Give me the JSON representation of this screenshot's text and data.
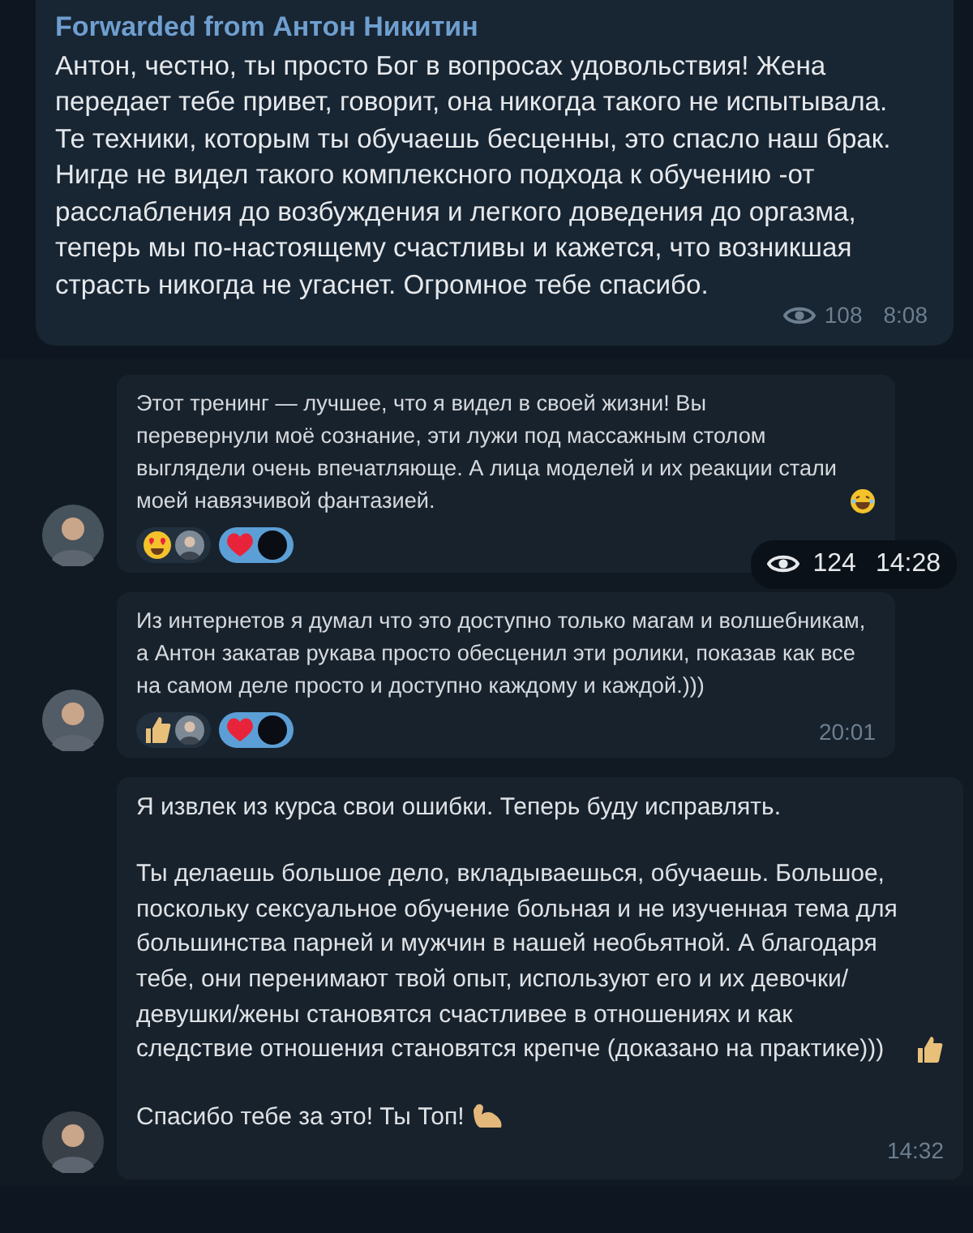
{
  "forwarded": {
    "header": "Forwarded from Антон Никитин",
    "text": "Антон, честно, ты просто Бог в вопросах удовольствия!  Жена передает тебе привет, говорит, она никогда такого не испытывала. Те техники, которым ты обучаешь бесценны, это спасло наш брак. Нигде не видел такого комплексного подхода к обучению -от расслабления до возбуждения и легкого доведения до оргазма, теперь мы по-настоящему счастливы и кажется, что возникшая страсть никогда не угаснет. Огромное тебе спасибо.",
    "views": "108",
    "time": "8:08"
  },
  "messages": [
    {
      "kind": "compact",
      "paragraphs": [
        {
          "text": "Этот тренинг — лучшее, что я видел в своей жизни! Вы перевернули моё сознание, эти лужи под массажным столом выглядели очень впечатляюще. А лица моделей и их реакции стали моей навязчивой фантазией.",
          "kind": "laughing"
        }
      ],
      "reactions": [
        {
          "kind": "heart-eyes",
          "selected": false
        },
        {
          "kind": "heart",
          "selected": true
        }
      ],
      "overlay": {
        "views": "124",
        "time": "14:28"
      }
    },
    {
      "kind": "compact",
      "paragraphs": [
        {
          "text": "Из интернетов я думал что это доступно только магам и волшебникам, а Антон закатав рукава просто обесценил эти ролики, показав как все на самом деле просто и доступно каждому и каждой.)))"
        }
      ],
      "reactions": [
        {
          "kind": "thumbs-up",
          "selected": false
        },
        {
          "kind": "heart",
          "selected": true
        }
      ],
      "time": "20:01"
    },
    {
      "kind": "wide",
      "paragraphs": [
        {
          "text": "Я извлек из курса свои ошибки. Теперь буду исправлять."
        },
        {
          "text": "Ты делаешь большое дело, вкладываешься, обучаешь. Большое, поскольку сексуальное обучение больная и не изученная тема для большинства парней и мужчин в нашей необьятной. А благодаря тебе, они перенимают твой опыт, используют его и их девочки/девушки/жены становятся счастливее в отношениях и как следствие отношения становятся крепче (доказано на практике)))",
          "kind": "thumbs-up"
        },
        {
          "text": "Спасибо тебе за это! Ты Топ!",
          "kind": "flexed-arm"
        }
      ],
      "time": "14:32"
    }
  ]
}
